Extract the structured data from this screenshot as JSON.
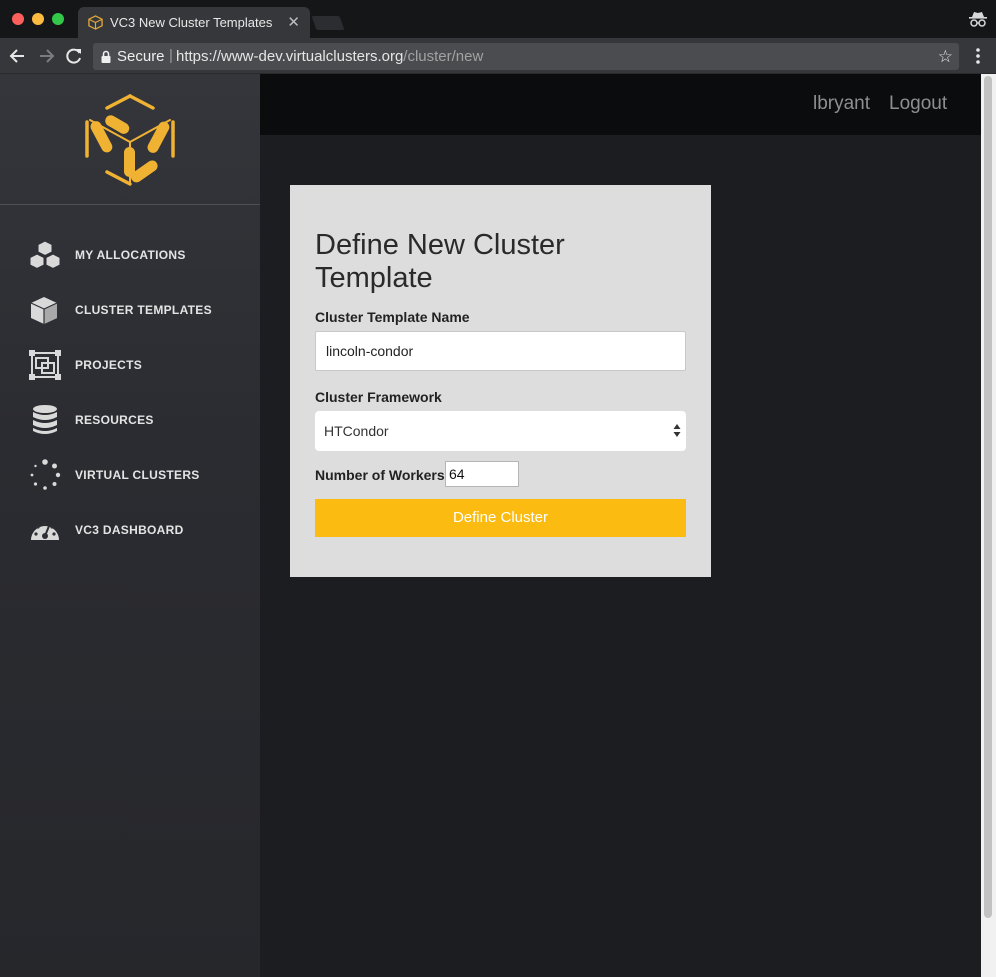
{
  "browser": {
    "tab_title": "VC3 New Cluster Templates",
    "tab_close": "✕",
    "secure_label": "Secure",
    "separator": "|",
    "url_base": "https://www-dev.virtualclusters.org",
    "url_path": "/cluster/new",
    "star": "☆",
    "menu": "⋮"
  },
  "icons": {
    "favicon": "vc3-cube-icon",
    "back": "arrow-left-icon",
    "forward": "arrow-right-icon",
    "reload": "reload-icon",
    "lock": "lock-icon",
    "incognito": "incognito-icon",
    "logo": "vc3-logo-icon"
  },
  "sidebar": {
    "items": [
      {
        "label": "MY ALLOCATIONS",
        "icon": "cubes-icon"
      },
      {
        "label": "CLUSTER TEMPLATES",
        "icon": "cube-icon"
      },
      {
        "label": "PROJECTS",
        "icon": "projects-icon"
      },
      {
        "label": "RESOURCES",
        "icon": "database-icon"
      },
      {
        "label": "VIRTUAL CLUSTERS",
        "icon": "spinner-icon"
      },
      {
        "label": "VC3 DASHBOARD",
        "icon": "dashboard-icon"
      }
    ]
  },
  "header": {
    "username": "lbryant",
    "logout": "Logout"
  },
  "form": {
    "title": "Define New Cluster Template",
    "name_label": "Cluster Template Name",
    "name_value": "lincoln-condor",
    "framework_label": "Cluster Framework",
    "framework_value": "HTCondor",
    "workers_label": "Number of Workers:",
    "workers_value": "64",
    "submit_label": "Define Cluster"
  },
  "colors": {
    "accent": "#fbbb10",
    "logo": "#f0b232",
    "sidebar": "#2b2c31",
    "topbar": "#0b0c0d",
    "card": "#dddddd"
  }
}
